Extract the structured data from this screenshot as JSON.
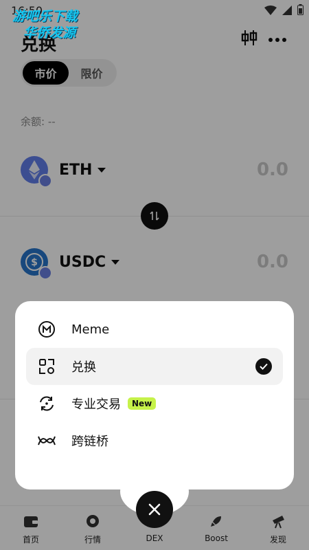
{
  "status_bar": {
    "time": "16:50"
  },
  "watermark": {
    "line1": "游吧乐下载",
    "line2": "华侨发源"
  },
  "header": {
    "title": "兑换"
  },
  "order_type": {
    "market": "市价",
    "limit": "限价"
  },
  "balance": {
    "label": "余额: --"
  },
  "from_token": {
    "symbol": "ETH",
    "amount": "0.0",
    "color": "#627eea"
  },
  "to_token": {
    "symbol": "USDC",
    "amount": "0.0",
    "color": "#2775ca"
  },
  "menu": {
    "items": [
      {
        "label": "Meme",
        "icon": "meme-icon"
      },
      {
        "label": "兑换",
        "icon": "swap-scan-icon",
        "selected": true
      },
      {
        "label": "专业交易",
        "icon": "pro-trade-icon",
        "badge": "New"
      },
      {
        "label": "跨链桥",
        "icon": "bridge-icon"
      }
    ]
  },
  "bottom_nav": {
    "items": [
      {
        "label": "首页",
        "icon": "wallet-icon"
      },
      {
        "label": "行情",
        "icon": "market-icon"
      },
      {
        "label": "DEX",
        "icon": "dex-icon"
      },
      {
        "label": "Boost",
        "icon": "rocket-icon"
      },
      {
        "label": "发现",
        "icon": "telescope-icon"
      }
    ]
  },
  "colors": {
    "accent_badge": "#c6f24a",
    "dark": "#111111"
  }
}
